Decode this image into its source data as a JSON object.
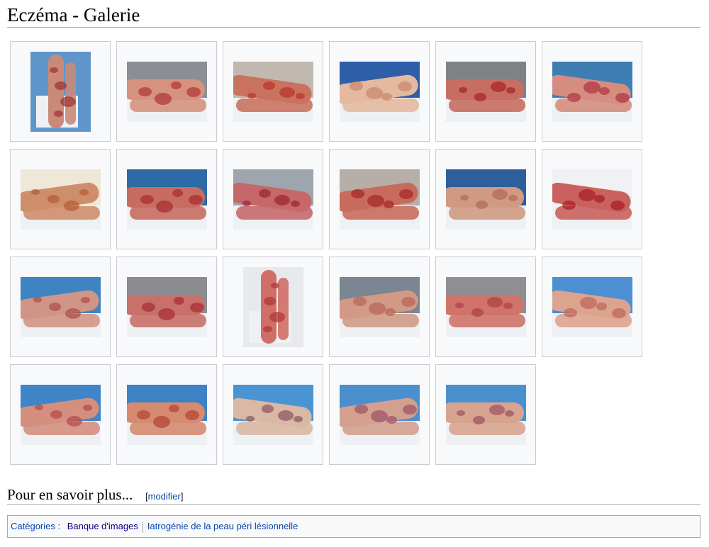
{
  "page": {
    "title": "Eczéma - Galerie"
  },
  "gallery": {
    "items": [
      {
        "shape": "portrait",
        "skin": "#c98a7a",
        "rash": "#a33434",
        "bg": "#5f95c9"
      },
      {
        "shape": "landscape",
        "skin": "#d5927f",
        "rash": "#b23a3a",
        "bg": "#8b8f94"
      },
      {
        "shape": "landscape",
        "skin": "#c9735f",
        "rash": "#b8362f",
        "bg": "#c1b9b0"
      },
      {
        "shape": "landscape",
        "skin": "#e3b9a0",
        "rash": "#c98a6d",
        "bg": "#2f5ea8"
      },
      {
        "shape": "landscape",
        "skin": "#c76d61",
        "rash": "#a8262e",
        "bg": "#7f8184"
      },
      {
        "shape": "landscape",
        "skin": "#d58d7f",
        "rash": "#b03945",
        "bg": "#3f7eb3"
      },
      {
        "shape": "landscape",
        "skin": "#cf8e6b",
        "rash": "#b65e3a",
        "bg": "#efe8d8"
      },
      {
        "shape": "landscape",
        "skin": "#c86c62",
        "rash": "#a82f34",
        "bg": "#2d6ba6"
      },
      {
        "shape": "landscape",
        "skin": "#c6686a",
        "rash": "#9a2a2f",
        "bg": "#9ea5ad"
      },
      {
        "shape": "landscape",
        "skin": "#c96b5c",
        "rash": "#a52a27",
        "bg": "#b6aea7"
      },
      {
        "shape": "landscape",
        "skin": "#d09a82",
        "rash": "#b36b57",
        "bg": "#2d5f9c"
      },
      {
        "shape": "landscape",
        "skin": "#c9625e",
        "rash": "#a52226",
        "bg": "#f1f0f2"
      },
      {
        "shape": "landscape",
        "skin": "#d09586",
        "rash": "#b0504a",
        "bg": "#3e84c2"
      },
      {
        "shape": "landscape",
        "skin": "#c9706a",
        "rash": "#a83037",
        "bg": "#8a8c90"
      },
      {
        "shape": "portrait",
        "skin": "#cf6f67",
        "rash": "#b1383a",
        "bg": "#e8e9ec"
      },
      {
        "shape": "landscape",
        "skin": "#d29a86",
        "rash": "#b7685a",
        "bg": "#7c8592"
      },
      {
        "shape": "landscape",
        "skin": "#cf736b",
        "rash": "#b0404a",
        "bg": "#8f8f93"
      },
      {
        "shape": "landscape",
        "skin": "#dba48e",
        "rash": "#c0675e",
        "bg": "#4c8fd2"
      },
      {
        "shape": "landscape",
        "skin": "#d48f7f",
        "rash": "#b64b4e",
        "bg": "#3f86c9"
      },
      {
        "shape": "landscape",
        "skin": "#d58b70",
        "rash": "#b54538",
        "bg": "#3d82c4"
      },
      {
        "shape": "landscape",
        "skin": "#d9b8a5",
        "rash": "#8f5a66",
        "bg": "#4a94d3"
      },
      {
        "shape": "landscape",
        "skin": "#d3a08f",
        "rash": "#9d5764",
        "bg": "#4b8fcf"
      },
      {
        "shape": "landscape",
        "skin": "#d7a48f",
        "rash": "#9f5562",
        "bg": "#4a90cf"
      }
    ]
  },
  "section": {
    "heading": "Pour en savoir plus...",
    "edit_open": "[",
    "edit_link": "modifier",
    "edit_close": "]"
  },
  "categories": {
    "label": "Catégories",
    "colon": ":",
    "items": [
      "Banque d'images",
      "Iatrogénie de la peau péri lésionnelle"
    ]
  }
}
